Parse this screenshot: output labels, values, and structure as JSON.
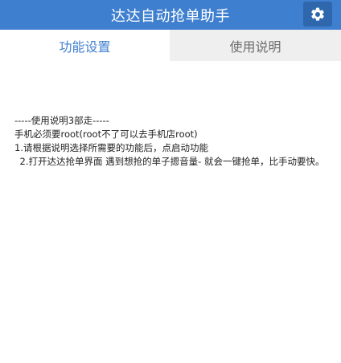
{
  "header": {
    "title": "达达自动抢单助手",
    "settings_icon": "gear-icon"
  },
  "tabs": [
    {
      "label": "功能设置",
      "active": true
    },
    {
      "label": "使用说明",
      "active": false
    }
  ],
  "instructions": {
    "heading": "-----使用说明3部走-----",
    "lines": [
      "手机必须要root(root不了可以去手机店root)",
      "1.请根据说明选择所需要的功能后，点启动功能",
      "2.打开达达抢单界面 遇到想抢的单子摁音量- 就会一键抢单，比手动要快。"
    ]
  },
  "colors": {
    "accent": "#3f7fcf",
    "settings_bg": "#2f67ad",
    "tab_inactive_bg": "#efefef"
  }
}
